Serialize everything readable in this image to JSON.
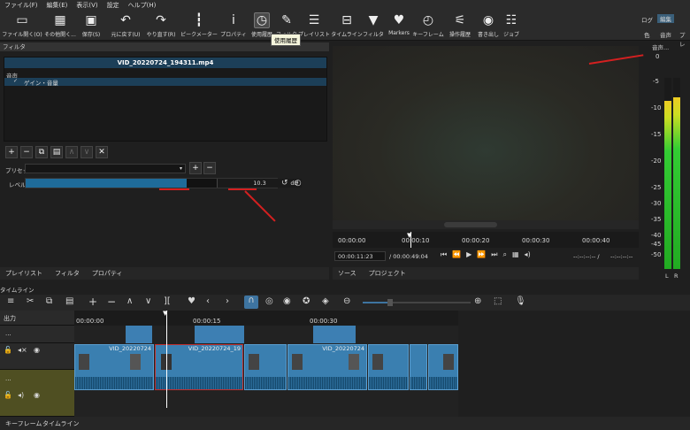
{
  "menu": [
    "ファイル(F)",
    "編集(E)",
    "表示(V)",
    "設定",
    "ヘルプ(H)"
  ],
  "toolbar": [
    {
      "label": "ファイル開く(O)",
      "icon": "folder-icon"
    },
    {
      "label": "その他開く...",
      "icon": "film-icon"
    },
    {
      "label": "保存(S)",
      "icon": "save-icon"
    },
    {
      "label": "元に戻す(U)",
      "icon": "undo-icon"
    },
    {
      "label": "やり直す(R)",
      "icon": "redo-icon"
    },
    {
      "label": "ピークメーター",
      "icon": "peak-meter-icon"
    },
    {
      "label": "プロパティ",
      "icon": "info-icon"
    },
    {
      "label": "使用履歴",
      "icon": "history-icon"
    },
    {
      "label": "フィルタ",
      "icon": "filter-icon"
    },
    {
      "label": "プレイリスト",
      "icon": "playlist-icon"
    },
    {
      "label": "タイムライン",
      "icon": "timeline-icon"
    },
    {
      "label": "フィルタ",
      "icon": "filter-funnel-icon"
    },
    {
      "label": "Markers",
      "icon": "marker-icon"
    },
    {
      "label": "キーフレーム",
      "icon": "stopwatch-icon"
    },
    {
      "label": "操作履歴",
      "icon": "jobs-icon"
    },
    {
      "label": "書き出し",
      "icon": "export-icon"
    },
    {
      "label": "ジョブ",
      "icon": "job-icon"
    }
  ],
  "layout_tabs": {
    "log": "ログ",
    "edit": "編集",
    "color": "色",
    "audio": "音声",
    "play": "プレ"
  },
  "tooltip": "使用履歴",
  "filter_panel": {
    "title": "フィルタ",
    "file": "VID_20220724_194311.mp4",
    "category": "音声",
    "item": "ゲイン・音量",
    "preset_label": "プリセット",
    "level_label": "レベル",
    "level_value": "10.3",
    "level_unit": "dB",
    "level_fraction": 0.64
  },
  "left_tabs": [
    "プレイリスト",
    "フィルタ",
    "プロパティ"
  ],
  "viewer": {
    "ruler_labels": [
      "00:00:00",
      "00:00:10",
      "00:00:20",
      "00:00:30",
      "00:00:40"
    ],
    "timecode": "00:00:11:23",
    "duration": "/ 00:00:49:04",
    "inout": "--:--:--:-- /",
    "inout2": "--:--:--:--",
    "tabs": [
      "ソース",
      "プロジェクト"
    ]
  },
  "audio_meter": {
    "title": "音声...",
    "scale": [
      "0",
      "-5",
      "-10",
      "-15",
      "-20",
      "-25",
      "-30",
      "-35",
      "-40",
      "-45",
      "-50"
    ],
    "left_label": "L",
    "right_label": "R",
    "left_db": -6,
    "right_db": -5
  },
  "timeline": {
    "title": "タイムライン",
    "output_label": "出力",
    "ruler": [
      "00:00:00",
      "00:00:15",
      "00:00:30"
    ],
    "clip_label_1": "VID_20220724",
    "clip_label_2": "VID_20220724_19",
    "clip_label_3": "VID_20220724",
    "track_dots": "...",
    "track_dots2": "..."
  },
  "bottom_tabs": [
    "キーフレーム",
    "タイムライン"
  ]
}
